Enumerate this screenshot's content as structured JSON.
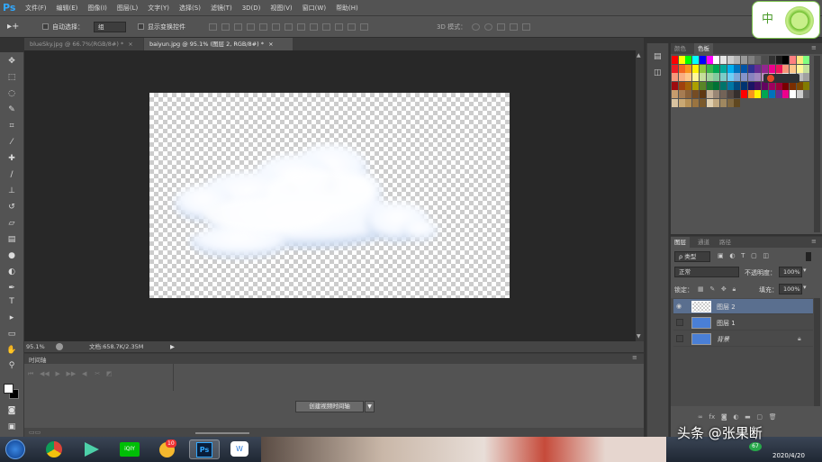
{
  "app": {
    "logo": "Ps"
  },
  "menu": [
    "文件(F)",
    "编辑(E)",
    "图像(I)",
    "图层(L)",
    "文字(Y)",
    "选择(S)",
    "滤镜(T)",
    "3D(D)",
    "视图(V)",
    "窗口(W)",
    "帮助(H)"
  ],
  "options": {
    "auto_select_label": "自动选择：",
    "auto_select_value": "组",
    "show_transform_label": "显示变换控件",
    "mode_3d_label": "3D 模式："
  },
  "tabs": [
    {
      "label": "blueSky.jpg @ 66.7%(RGB/8#) *"
    },
    {
      "label": "baiyun.jpg @ 95.1% (图层 2, RGB/8#) *"
    }
  ],
  "status": {
    "zoom": "95.1%",
    "doc_info": "文档:658.7K/2.35M"
  },
  "timeline": {
    "title": "时间轴",
    "create_button": "创建视频时间轴"
  },
  "color_panel": {
    "tabs": [
      "颜色",
      "色板"
    ]
  },
  "layers_panel": {
    "tabs": [
      "图层",
      "通道",
      "路径"
    ],
    "filter_label": "ρ 类型",
    "blend_mode": "正常",
    "opacity_label": "不透明度：",
    "opacity_value": "100%",
    "lock_label": "锁定：",
    "fill_label": "填充：",
    "fill_value": "100%",
    "layers": [
      {
        "name": "图层 2",
        "selected": true,
        "visible": true
      },
      {
        "name": "图层 1",
        "selected": false,
        "visible": false
      },
      {
        "name": "背景",
        "selected": false,
        "visible": false,
        "locked": true
      }
    ]
  },
  "ime": {
    "label": "中"
  },
  "watermark": {
    "text": "头条 @张果断",
    "date": "2020/4/20"
  },
  "taskbar": {
    "badge_count": "10",
    "tray_number": "67"
  },
  "colors": {
    "accent_ps": "#31a8ff",
    "selected_layer": "#5a6f8f",
    "panel_bg": "#535353",
    "canvas_bg": "#282828"
  }
}
